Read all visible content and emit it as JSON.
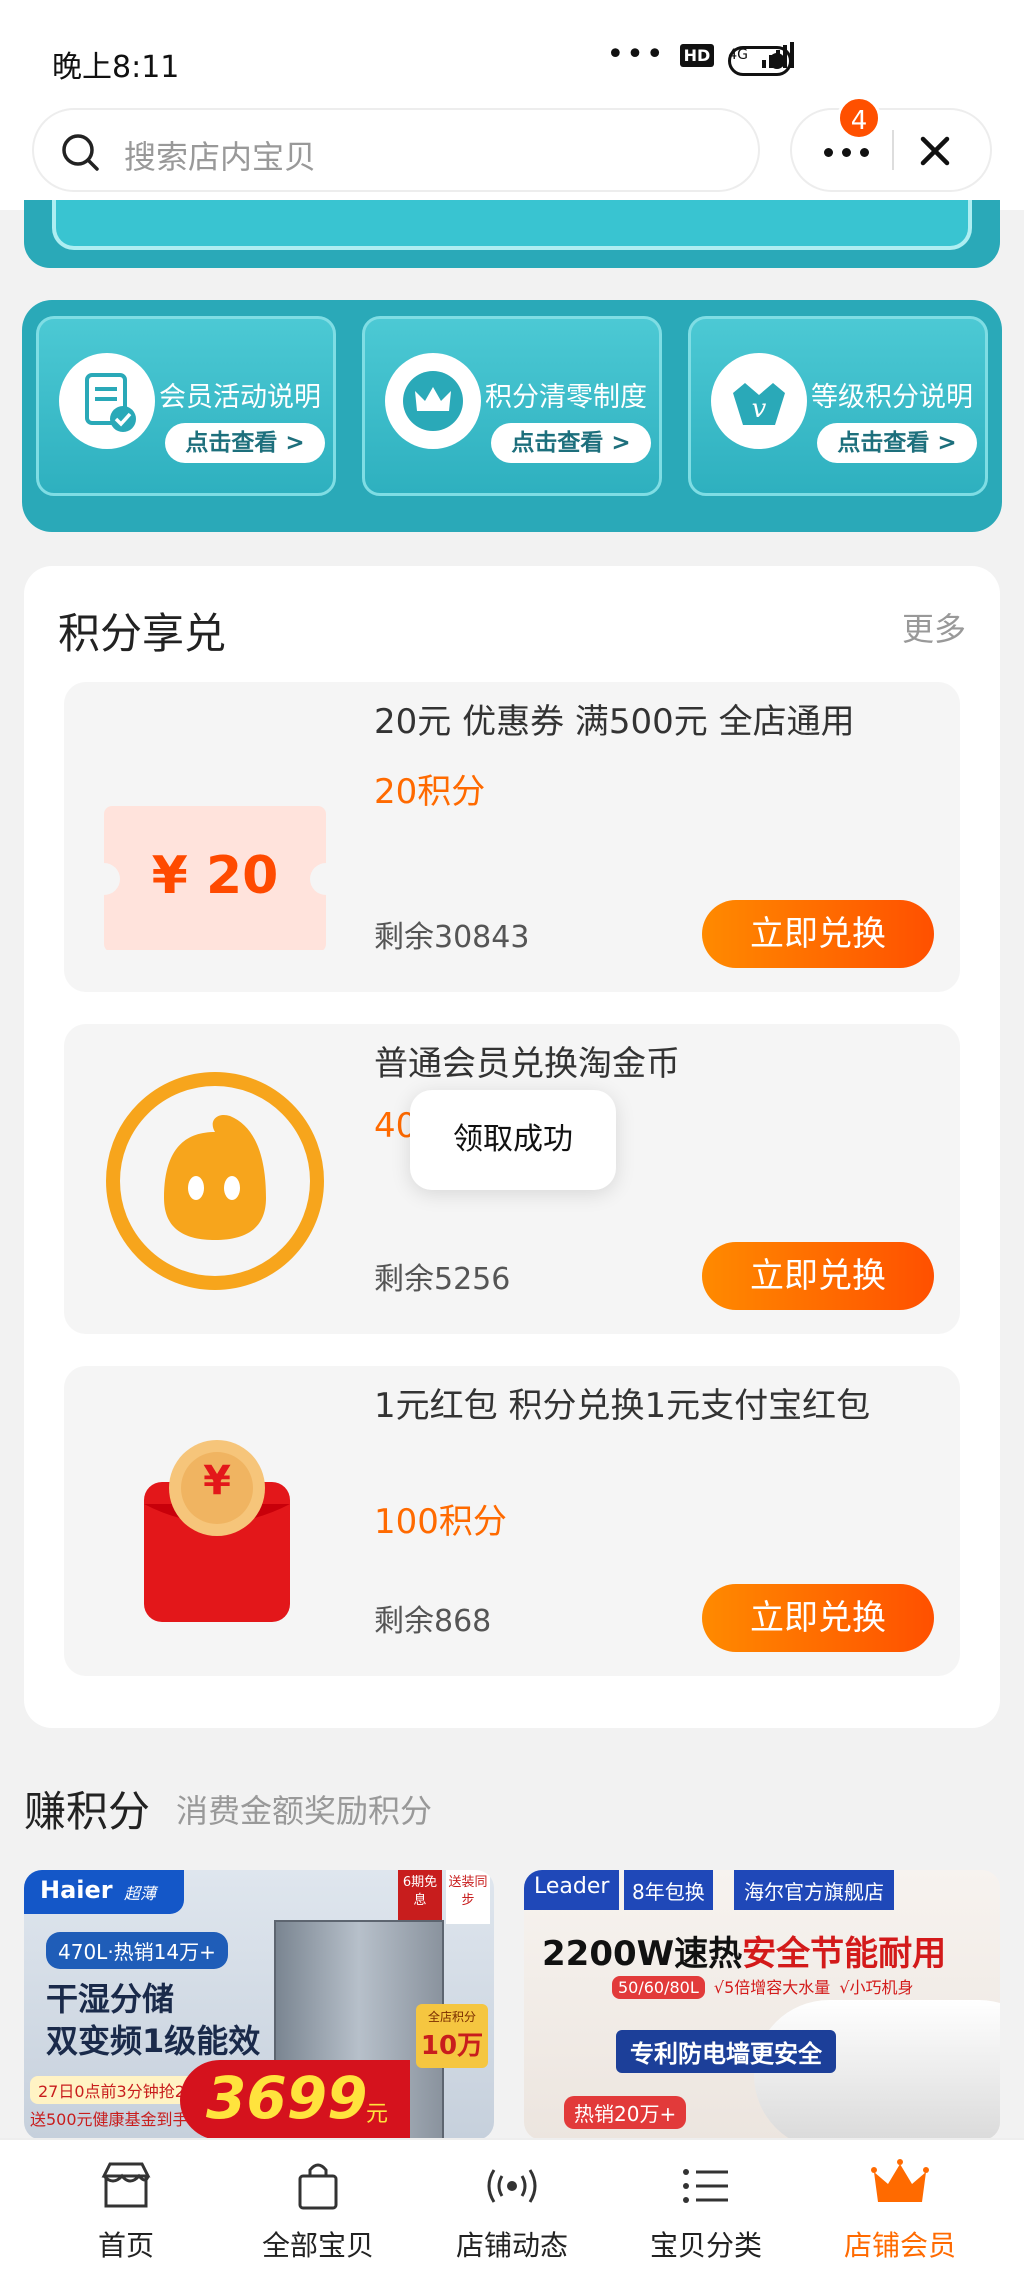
{
  "status_bar": {
    "time": "晚上8:11",
    "network": "4G",
    "hd": "HD"
  },
  "header": {
    "search_placeholder": "搜索店内宝贝",
    "badge_count": "4"
  },
  "member_cards": [
    {
      "title": "会员活动说明",
      "button": "点击查看 >"
    },
    {
      "title": "积分清零制度",
      "button": "点击查看 >"
    },
    {
      "title": "等级积分说明",
      "button": "点击查看 >"
    }
  ],
  "points_exchange": {
    "title": "积分享兑",
    "more": "更多",
    "items": [
      {
        "name": "20元 优惠券 满500元 全店通用",
        "points": "20积分",
        "remaining": "剩余30843",
        "button": "立即兑换",
        "coupon_value": "¥ 20"
      },
      {
        "name": "普通会员兑换淘金币",
        "points": "40",
        "remaining": "剩余5256",
        "button": "立即兑换"
      },
      {
        "name": "1元红包 积分兑换1元支付宝红包",
        "points": "100积分",
        "remaining": "剩余868",
        "button": "立即兑换",
        "envelope_symbol": "¥"
      }
    ]
  },
  "toast": "领取成功",
  "earn": {
    "title": "赚积分",
    "subtitle": "消费金额奖励积分",
    "promos": [
      {
        "brand": "Haier",
        "sub_brand": "超薄",
        "tag1": "6期免息",
        "tag2": "送装同步",
        "spec": "470L·热销14万+",
        "headline1": "干湿分储",
        "headline2": "双变频1级能效",
        "promo_line": "27日0点前3分钟抢20台",
        "gift": "送500元健康基金到手",
        "price": "3699",
        "price_unit": "元",
        "points_badge": "全店积分",
        "points_amount": "10万"
      },
      {
        "brand": "Leader",
        "warranty": "8年包换",
        "store": "海尔官方旗舰店",
        "headline_black": "2200W速热",
        "headline_red": "安全节能耐用",
        "capacities": "50/60/80L",
        "feature1": "√5倍增容大水量",
        "feature2": "√小巧机身",
        "wall": "专利防电墙更安全",
        "sales": "热销20万+"
      }
    ]
  },
  "bottom_nav": [
    {
      "label": "首页",
      "icon": "store-icon"
    },
    {
      "label": "全部宝贝",
      "icon": "bag-icon"
    },
    {
      "label": "店铺动态",
      "icon": "broadcast-icon"
    },
    {
      "label": "宝贝分类",
      "icon": "list-icon"
    },
    {
      "label": "店铺会员",
      "icon": "crown-icon"
    }
  ],
  "colors": {
    "accent": "#ff6a00",
    "teal": "#2aa9b8",
    "button_gradient_start": "#ff8a00",
    "button_gradient_end": "#ff5000"
  }
}
